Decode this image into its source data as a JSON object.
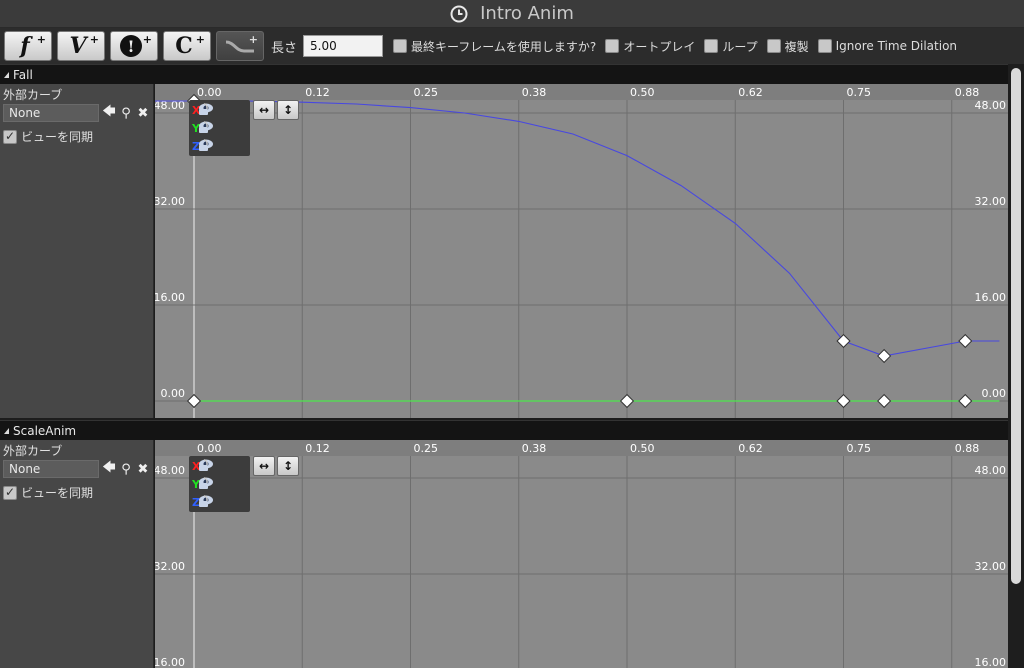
{
  "window": {
    "title": "Intro Anim",
    "icon": "clock-icon"
  },
  "toolbar": {
    "buttons": [
      {
        "glyph": "f",
        "icon": "add-float-track-icon"
      },
      {
        "glyph": "V",
        "icon": "add-vector-track-icon"
      },
      {
        "glyph": "!",
        "icon": "add-event-track-icon"
      },
      {
        "glyph": "C",
        "icon": "add-color-track-icon"
      },
      {
        "glyph": "",
        "icon": "add-curve-track-icon"
      }
    ],
    "plus": "+",
    "length_label": "長さ",
    "length_value": "5.00",
    "checkboxes": [
      {
        "label": "最終キーフレームを使用しますか?",
        "checked": false
      },
      {
        "label": "オートプレイ",
        "checked": false
      },
      {
        "label": "ループ",
        "checked": false
      },
      {
        "label": "複製",
        "checked": false
      },
      {
        "label": "Ignore Time Dilation",
        "checked": false
      }
    ]
  },
  "colors": {
    "x_axis": "#ff2020",
    "y_axis": "#20e020",
    "z_axis": "#3060ff",
    "curve_blue": "#4848e0",
    "curve_green": "#4ce64c"
  },
  "time_ticks": [
    "0.00",
    "0.12",
    "0.25",
    "0.38",
    "0.50",
    "0.62",
    "0.75",
    "0.88"
  ],
  "tracks": [
    {
      "name": "Fall",
      "external_curve_label": "外部カーブ",
      "external_curve_value": "None",
      "sync_view_label": "ビューを同期",
      "sync_view_checked": true,
      "value_ticks": [
        "48.00",
        "32.00",
        "16.00",
        "0.00"
      ],
      "axes": [
        "X",
        "Y",
        "Z"
      ],
      "fit_horizontal_label": "↔",
      "fit_vertical_label": "↕",
      "blue_curve": [
        [
          0.0,
          50.0
        ],
        [
          0.0625,
          50.0
        ],
        [
          0.125,
          49.8
        ],
        [
          0.1875,
          49.5
        ],
        [
          0.25,
          48.9
        ],
        [
          0.3125,
          48.0
        ],
        [
          0.375,
          46.6
        ],
        [
          0.4375,
          44.5
        ],
        [
          0.5,
          40.9
        ],
        [
          0.5625,
          35.9
        ],
        [
          0.625,
          29.6
        ],
        [
          0.6875,
          21.3
        ],
        [
          0.75,
          10.0
        ],
        [
          0.7969,
          7.5
        ],
        [
          0.8906,
          10.0
        ],
        [
          0.93,
          10.0
        ]
      ],
      "blue_keys": [
        [
          0.0,
          50.0
        ],
        [
          0.75,
          10.0
        ],
        [
          0.7969,
          7.5
        ],
        [
          0.8906,
          10.0
        ]
      ],
      "green_curve": [
        [
          0.0,
          0.0
        ],
        [
          0.93,
          0.0
        ]
      ],
      "green_keys": [
        [
          0.0,
          0.0
        ],
        [
          0.5,
          0.0
        ],
        [
          0.75,
          0.0
        ],
        [
          0.7969,
          0.0
        ],
        [
          0.8906,
          0.0
        ]
      ]
    },
    {
      "name": "ScaleAnim",
      "external_curve_label": "外部カーブ",
      "external_curve_value": "None",
      "sync_view_label": "ビューを同期",
      "sync_view_checked": true,
      "value_ticks": [
        "48.00",
        "32.00",
        "16.00"
      ],
      "axes": [
        "X",
        "Y",
        "Z"
      ],
      "fit_horizontal_label": "↔",
      "fit_vertical_label": "↕",
      "blue_curve": [],
      "blue_keys": [],
      "green_curve": [],
      "green_keys": []
    }
  ]
}
